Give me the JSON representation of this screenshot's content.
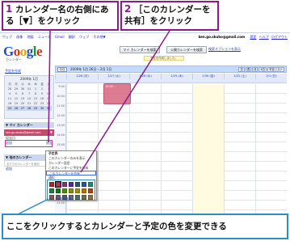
{
  "callouts": {
    "step1": {
      "num": "1",
      "text": "カレンダー名の右側にある［▼］をクリック"
    },
    "step2": {
      "num": "2",
      "text": "［このカレンダーを共有］をクリック"
    },
    "bottom": "ここをクリックするとカレンダーと予定の色を変更できる"
  },
  "gbar": {
    "links": [
      "ウェブ",
      "画像",
      "地図",
      "ニュース",
      "Gmail",
      "翻訳",
      "ウェブ",
      "その他▼"
    ],
    "account": "ken.go.skubo@gmail.com",
    "account_links": [
      "設定",
      "ヘルプ",
      "ログアウト"
    ]
  },
  "logo": {
    "b": "G",
    "r": "o",
    "y": "o",
    "b2": "g",
    "g": "l",
    "r2": "e",
    "sub": "カレンダー"
  },
  "toolbar": {
    "search_my": "マイ カレンダーを検索",
    "search_public": "公開カレンダーを検索",
    "show_options": "検索オプションを表示",
    "hint": "予定を作成しました。",
    "new_event": "予定を作成"
  },
  "minical": {
    "title": "2009年 1月",
    "weekdays": [
      "日",
      "月",
      "火",
      "水",
      "木",
      "金",
      "土"
    ],
    "days": [
      "28",
      "29",
      "30",
      "31",
      "1",
      "2",
      "3",
      "4",
      "5",
      "6",
      "7",
      "8",
      "9",
      "10",
      "11",
      "12",
      "13",
      "14",
      "15",
      "16",
      "17",
      "18",
      "19",
      "20",
      "21",
      "22",
      "23",
      "24",
      "25",
      "26",
      "27",
      "28",
      "29",
      "30",
      "31"
    ]
  },
  "sidebar": {
    "my_calendars": "▼ マイ カレンダー",
    "cal_name": "ken.go.skubo@gmail.com",
    "cal_dropdown": "▼",
    "cal2": "記念日",
    "links_left": "追加",
    "links_right": "設定",
    "other_calendars": "▼ 他のカレンダー",
    "other_placeholder": "友だちのカレンダーを追加",
    "other_left": "追加",
    "other_right": "設定"
  },
  "main": {
    "today": "今日",
    "range": "2009年 1月 26日 – 2月 1日",
    "views": [
      "日",
      "週",
      "月",
      "4日",
      "予定リスト"
    ],
    "days": [
      "1/26 (月)",
      "1/27 (火)",
      "1/28 (水)",
      "1/29 (木)",
      "1/30 (金)",
      "1/31 (土)",
      "2/1 (日)"
    ],
    "hours": [
      "9:00",
      "10:00",
      "11:00",
      "12:00",
      "13:00",
      "14:00",
      "15:00",
      "16:00",
      "17:00",
      "18:00",
      "19:00",
      "20:00",
      "21:00"
    ],
    "event": "12:00 –"
  },
  "menu": {
    "header": "予定表",
    "items": [
      "このカレンダーのみを表示",
      "カレンダー設定",
      "このカレンダーに予定を作成",
      "このカレンダーを共有",
      "通知"
    ],
    "custom": "カスタム色を選択",
    "colors": [
      "#a32929",
      "#b1365f",
      "#7a367a",
      "#5229a3",
      "#29527a",
      "#2952a3",
      "#1b887a",
      "#28754e",
      "#0d7813",
      "#528800",
      "#88880e",
      "#ab8b00",
      "#be6d00",
      "#b1440e",
      "#865a5a",
      "#705770",
      "#4e5d6c",
      "#5a6986",
      "#4a716c",
      "#6e6e41",
      "#8d6f47"
    ],
    "current_color_index": 1
  },
  "colors": {
    "callout_border": "#8b1a8b",
    "bottom_border": "#2a8fc9",
    "highlight": "#e0249d",
    "calendar_pink": "#c54a6b"
  }
}
